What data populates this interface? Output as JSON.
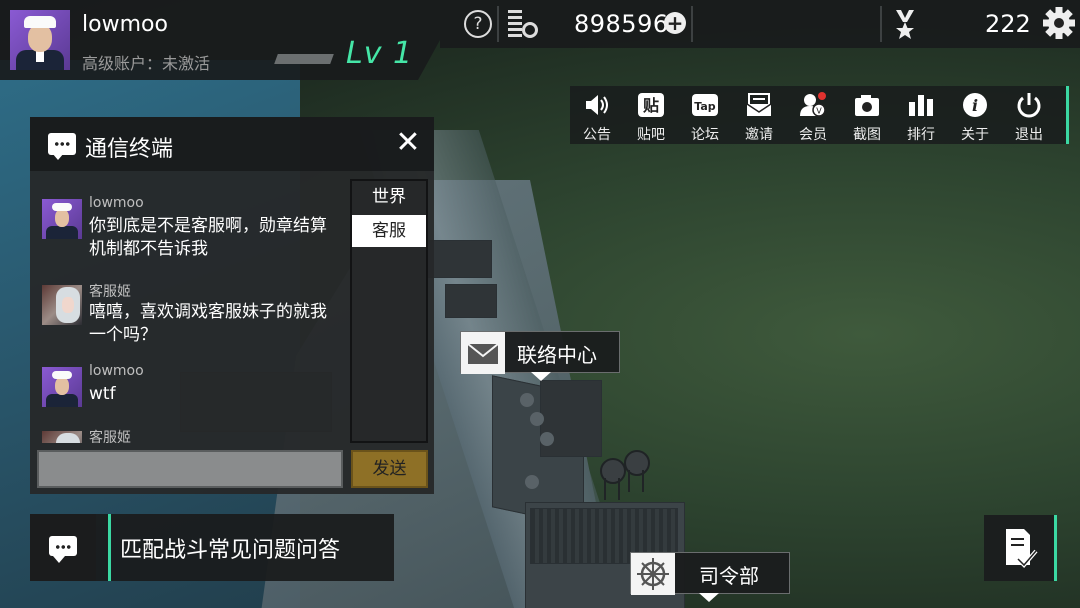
{
  "player": {
    "username": "lowmoo",
    "account_status": "高级账户：未激活",
    "level": "Lv 1"
  },
  "resources": {
    "coins": "898596",
    "medals": "222"
  },
  "menu": [
    {
      "label": "公告",
      "icon": "speaker-icon"
    },
    {
      "label": "贴吧",
      "icon": "tieba-icon"
    },
    {
      "label": "论坛",
      "icon": "taptap-icon"
    },
    {
      "label": "邀请",
      "icon": "envelope-icon"
    },
    {
      "label": "会员",
      "icon": "member-icon"
    },
    {
      "label": "截图",
      "icon": "camera-icon"
    },
    {
      "label": "排行",
      "icon": "ranking-icon"
    },
    {
      "label": "关于",
      "icon": "info-icon"
    },
    {
      "label": "退出",
      "icon": "power-icon"
    }
  ],
  "chat": {
    "title": "通信终端",
    "tabs": [
      "世界",
      "客服"
    ],
    "active_tab": "客服",
    "messages": [
      {
        "sender": "lowmoo",
        "text": "你到底是不是客服啊，勋章结算机制都不告诉我"
      },
      {
        "sender": "客服姬",
        "text": "嘻嘻，喜欢调戏客服妹子的就我一个吗？"
      },
      {
        "sender": "lowmoo",
        "text": "wtf"
      },
      {
        "sender": "客服姬",
        "text": ""
      }
    ],
    "input_value": "",
    "send_label": "发送"
  },
  "faq": {
    "label": "匹配战斗常见问题问答"
  },
  "buildings": {
    "contact_center": "联络中心",
    "headquarters": "司令部"
  },
  "colors": {
    "accent": "#3bd8a3",
    "level": "#45e6a7",
    "send_button": "#8e7026"
  }
}
